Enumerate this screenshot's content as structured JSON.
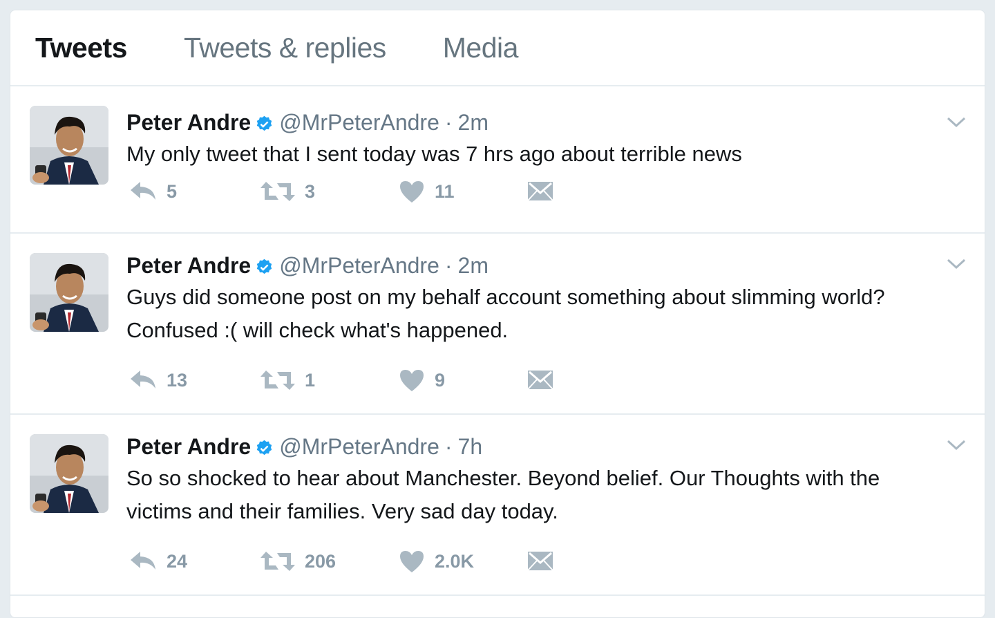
{
  "tabs": [
    {
      "label": "Tweets",
      "active": true
    },
    {
      "label": "Tweets & replies",
      "active": false
    },
    {
      "label": "Media",
      "active": false
    }
  ],
  "colors": {
    "verified": "#1da1f2",
    "icon": "#aab8c2",
    "text": "#14171a",
    "muted": "#657786"
  },
  "tweets": [
    {
      "name": "Peter Andre",
      "handle": "@MrPeterAndre",
      "separator": "·",
      "time": "2m",
      "lines": [
        "My only tweet that I sent today was 7 hrs ago about terrible news"
      ],
      "replies": "5",
      "retweets": "3",
      "likes": "11"
    },
    {
      "name": "Peter Andre",
      "handle": "@MrPeterAndre",
      "separator": "·",
      "time": "2m",
      "lines": [
        "Guys did someone post on my behalf account something about slimming world?",
        "Confused :( will check what's happened."
      ],
      "replies": "13",
      "retweets": "1",
      "likes": "9"
    },
    {
      "name": "Peter Andre",
      "handle": "@MrPeterAndre",
      "separator": "·",
      "time": "7h",
      "lines": [
        "So so shocked to hear about Manchester. Beyond belief. Our Thoughts with the",
        "victims and their families. Very sad day today."
      ],
      "replies": "24",
      "retweets": "206",
      "likes": "2.0K"
    }
  ]
}
